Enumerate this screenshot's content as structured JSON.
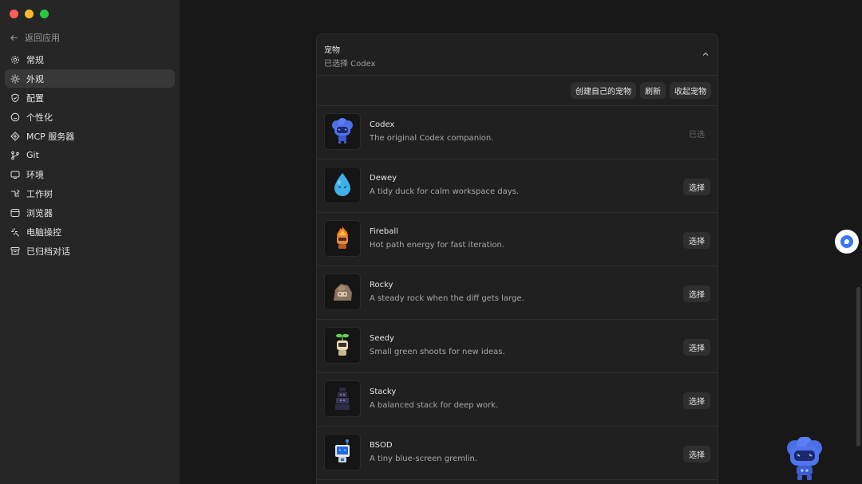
{
  "sidebar": {
    "back_label": "返回应用",
    "items": [
      {
        "label": "常规",
        "icon": "gear-icon"
      },
      {
        "label": "外观",
        "icon": "sun-icon",
        "active": true
      },
      {
        "label": "配置",
        "icon": "shield-icon"
      },
      {
        "label": "个性化",
        "icon": "smiley-icon"
      },
      {
        "label": "MCP 服务器",
        "icon": "server-icon"
      },
      {
        "label": "Git",
        "icon": "git-branch-icon"
      },
      {
        "label": "环境",
        "icon": "monitor-icon"
      },
      {
        "label": "工作树",
        "icon": "tree-icon"
      },
      {
        "label": "浏览器",
        "icon": "browser-icon"
      },
      {
        "label": "电脑操控",
        "icon": "sparkle-icon"
      },
      {
        "label": "已归档对话",
        "icon": "archive-icon"
      }
    ]
  },
  "panel": {
    "title": "宠物",
    "subtitle": "已选择 Codex",
    "actions": {
      "create": "创建自己的宠物",
      "refresh": "刷新",
      "collapse": "收起宠物"
    }
  },
  "pets": [
    {
      "name": "Codex",
      "desc": "The original Codex companion.",
      "action": "已选",
      "selected": true,
      "icon": "codex-pet-icon"
    },
    {
      "name": "Dewey",
      "desc": "A tidy duck for calm workspace days.",
      "action": "选择",
      "icon": "dewey-pet-icon"
    },
    {
      "name": "Fireball",
      "desc": "Hot path energy for fast iteration.",
      "action": "选择",
      "icon": "fireball-pet-icon"
    },
    {
      "name": "Rocky",
      "desc": "A steady rock when the diff gets large.",
      "action": "选择",
      "icon": "rocky-pet-icon"
    },
    {
      "name": "Seedy",
      "desc": "Small green shoots for new ideas.",
      "action": "选择",
      "icon": "seedy-pet-icon"
    },
    {
      "name": "Stacky",
      "desc": "A balanced stack for deep work.",
      "action": "选择",
      "icon": "stacky-pet-icon"
    },
    {
      "name": "BSOD",
      "desc": "A tiny blue-screen gremlin.",
      "action": "选择",
      "icon": "bsod-pet-icon"
    }
  ],
  "colors": {
    "close": "#ff5f57",
    "minimize": "#febc2e",
    "zoom": "#28c840",
    "accent": "#4a7dff",
    "sidebar_bg": "#262626",
    "panel_bg": "#202020"
  }
}
